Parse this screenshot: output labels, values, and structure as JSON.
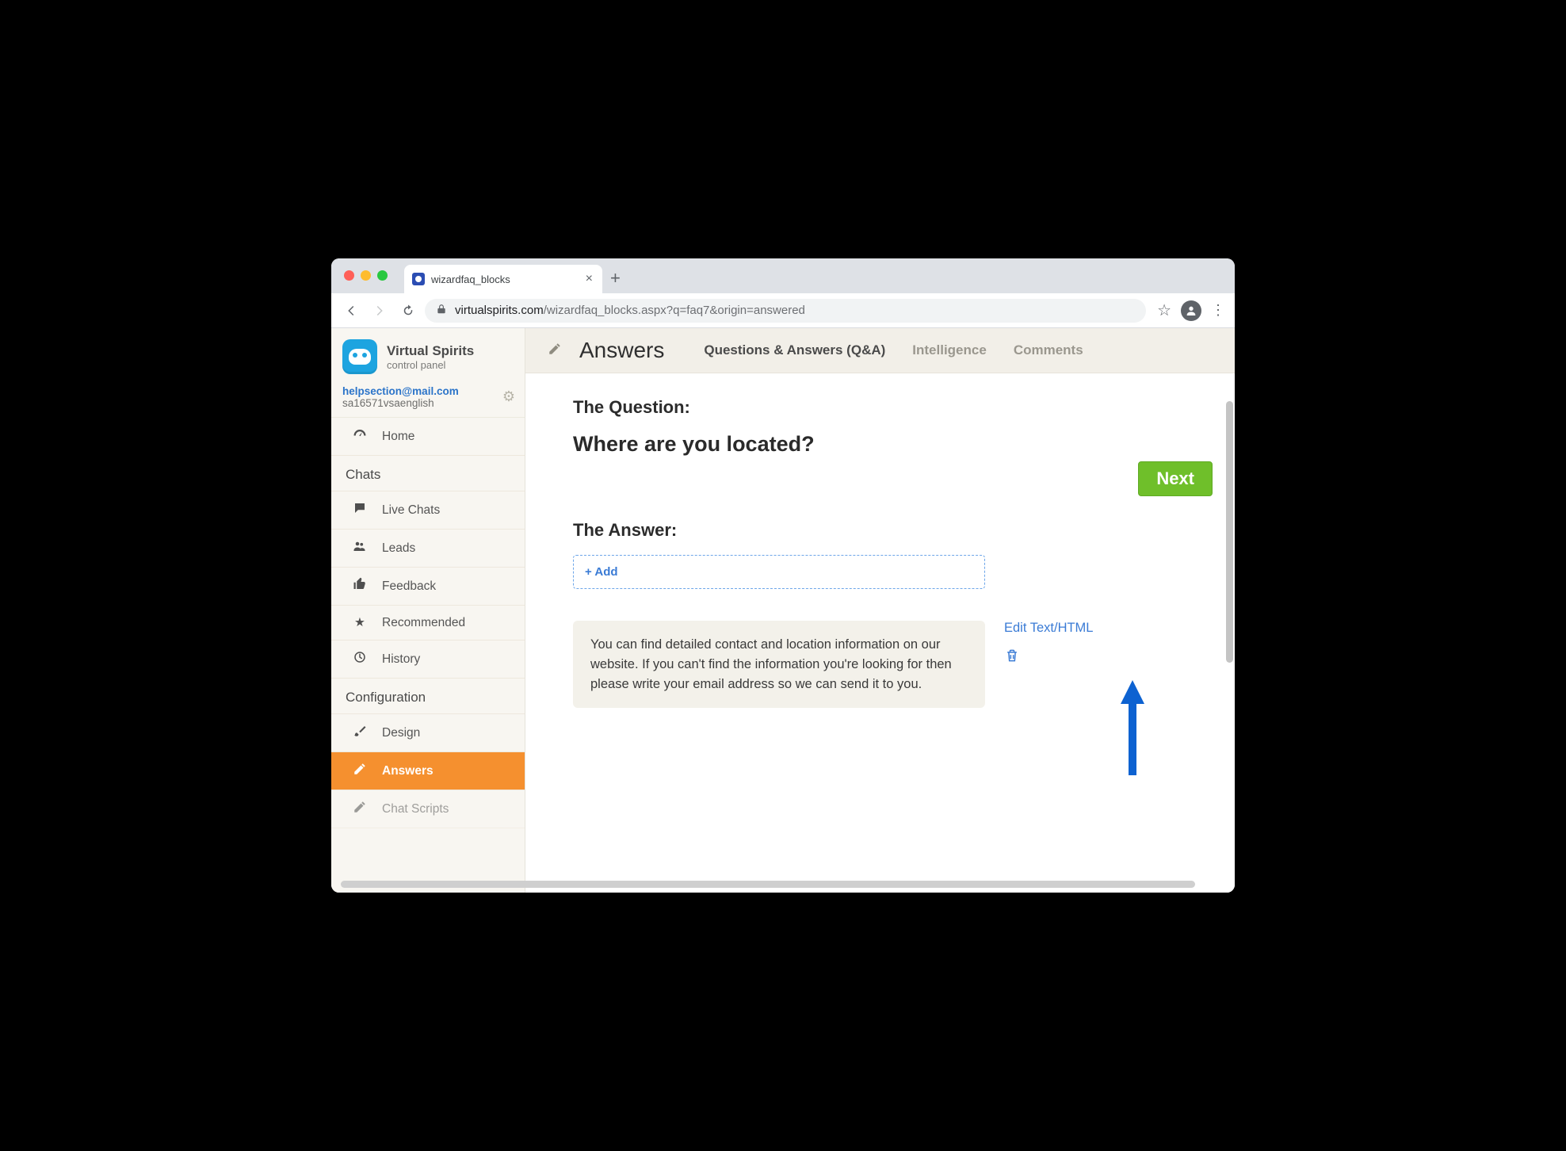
{
  "browser": {
    "tab_title": "wizardfaq_blocks",
    "url_host": "virtualspirits.com",
    "url_path": "/wizardfaq_blocks.aspx?q=faq7&origin=answered"
  },
  "brand": {
    "name": "Virtual Spirits",
    "subtitle": "control panel"
  },
  "account": {
    "email": "helpsection@mail.com",
    "id": "sa16571vsaenglish"
  },
  "sidebar": {
    "items": [
      {
        "icon": "gauge-icon",
        "label": "Home"
      }
    ],
    "chats_section": "Chats",
    "chats": [
      {
        "icon": "chat-icon",
        "label": "Live Chats"
      },
      {
        "icon": "leads-icon",
        "label": "Leads"
      },
      {
        "icon": "thumb-icon",
        "label": "Feedback"
      },
      {
        "icon": "star-icon",
        "label": "Recommended"
      },
      {
        "icon": "history-icon",
        "label": "History"
      }
    ],
    "config_section": "Configuration",
    "config": [
      {
        "icon": "brush-icon",
        "label": "Design"
      },
      {
        "icon": "pencil-icon",
        "label": "Answers",
        "active": true
      },
      {
        "icon": "pencil-icon",
        "label": "Chat Scripts"
      }
    ]
  },
  "header": {
    "title": "Answers",
    "tabs": [
      {
        "label": "Questions & Answers (Q&A)",
        "active": true
      },
      {
        "label": "Intelligence"
      },
      {
        "label": "Comments"
      }
    ]
  },
  "page": {
    "question_heading": "The Question:",
    "question_text": "Where are you located?",
    "next_label": "Next",
    "answer_heading": "The Answer:",
    "add_label": "+ Add",
    "answer_text": "You can find detailed contact and location information on our website. If you can't find the information you're looking for then please write your email address so we can send it to you.",
    "edit_link": "Edit Text/HTML"
  }
}
